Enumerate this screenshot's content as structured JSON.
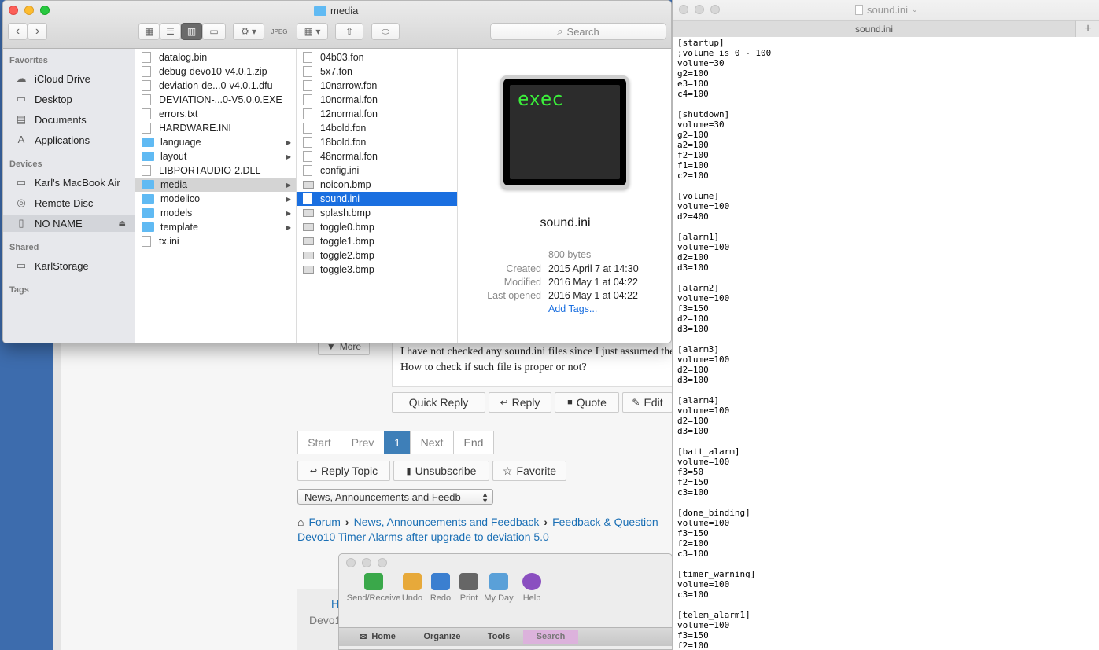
{
  "forum": {
    "more_label": "More",
    "post_line1": "I have not checked any sound.ini files since I just assumed the",
    "post_line2": "How to check if such file is proper or not?",
    "quick_reply": "Quick Reply",
    "reply": "Reply",
    "quote": "Quote",
    "edit": "Edit",
    "pagination": [
      "Start",
      "Prev",
      "1",
      "Next",
      "End"
    ],
    "reply_topic": "Reply Topic",
    "unsubscribe": "Unsubscribe",
    "favorite": "Favorite",
    "category_select": "News, Announcements and Feedb",
    "breadcrumb": [
      "Forum",
      "News, Announcements and Feedback",
      "Feedback & Question"
    ],
    "topic_title": "Devo10 Timer Alarms after upgrade to deviation 5.0",
    "footer_h": "H",
    "footer_devo": "Devo1"
  },
  "finder": {
    "title": "media",
    "search_placeholder": "Search",
    "sidebar": {
      "favorites_header": "Favorites",
      "favorites": [
        {
          "label": "iCloud Drive",
          "icon": "cloud-icon"
        },
        {
          "label": "Desktop",
          "icon": "desktop-icon"
        },
        {
          "label": "Documents",
          "icon": "documents-icon"
        },
        {
          "label": "Applications",
          "icon": "applications-icon"
        }
      ],
      "devices_header": "Devices",
      "devices": [
        {
          "label": "Karl's MacBook Air",
          "icon": "laptop-icon"
        },
        {
          "label": "Remote Disc",
          "icon": "disc-icon"
        },
        {
          "label": "NO NAME",
          "icon": "drive-icon"
        }
      ],
      "shared_header": "Shared",
      "shared": [
        {
          "label": "KarlStorage",
          "icon": "server-icon"
        }
      ],
      "tags_header": "Tags"
    },
    "column1": [
      {
        "name": "datalog.bin",
        "kind": "file"
      },
      {
        "name": "debug-devo10-v4.0.1.zip",
        "kind": "file"
      },
      {
        "name": "deviation-de...0-v4.0.1.dfu",
        "kind": "file"
      },
      {
        "name": "DEVIATION-...0-V5.0.0.EXE",
        "kind": "file"
      },
      {
        "name": "errors.txt",
        "kind": "file"
      },
      {
        "name": "HARDWARE.INI",
        "kind": "file"
      },
      {
        "name": "language",
        "kind": "folder"
      },
      {
        "name": "layout",
        "kind": "folder"
      },
      {
        "name": "LIBPORTAUDIO-2.DLL",
        "kind": "file"
      },
      {
        "name": "media",
        "kind": "folder"
      },
      {
        "name": "modelico",
        "kind": "folder"
      },
      {
        "name": "models",
        "kind": "folder"
      },
      {
        "name": "template",
        "kind": "folder"
      },
      {
        "name": "tx.ini",
        "kind": "file"
      }
    ],
    "column2": [
      {
        "name": "04b03.fon",
        "kind": "file"
      },
      {
        "name": "5x7.fon",
        "kind": "file"
      },
      {
        "name": "10narrow.fon",
        "kind": "file"
      },
      {
        "name": "10normal.fon",
        "kind": "file"
      },
      {
        "name": "12normal.fon",
        "kind": "file"
      },
      {
        "name": "14bold.fon",
        "kind": "file"
      },
      {
        "name": "18bold.fon",
        "kind": "file"
      },
      {
        "name": "48normal.fon",
        "kind": "file"
      },
      {
        "name": "config.ini",
        "kind": "file"
      },
      {
        "name": "noicon.bmp",
        "kind": "image"
      },
      {
        "name": "sound.ini",
        "kind": "file"
      },
      {
        "name": "splash.bmp",
        "kind": "image"
      },
      {
        "name": "toggle0.bmp",
        "kind": "image"
      },
      {
        "name": "toggle1.bmp",
        "kind": "image"
      },
      {
        "name": "toggle2.bmp",
        "kind": "image"
      },
      {
        "name": "toggle3.bmp",
        "kind": "image"
      }
    ],
    "preview": {
      "icon_text": "exec",
      "filename": "sound.ini",
      "size": "800 bytes",
      "created_label": "Created",
      "created": "2015 April 7 at 14:30",
      "modified_label": "Modified",
      "modified": "2016 May 1 at 04:22",
      "opened_label": "Last opened",
      "opened": "2016 May 1 at 04:22",
      "add_tags": "Add Tags..."
    }
  },
  "textedit": {
    "title": "sound.ini",
    "tab": "sound.ini",
    "content": "[startup]\n;volume is 0 - 100\nvolume=30\ng2=100\ne3=100\nc4=100\n\n[shutdown]\nvolume=30\ng2=100\na2=100\nf2=100\nf1=100\nc2=100\n\n[volume]\nvolume=100\nd2=400\n\n[alarm1]\nvolume=100\nd2=100\nd3=100\n\n[alarm2]\nvolume=100\nf3=150\nd2=100\nd3=100\n\n[alarm3]\nvolume=100\nd2=100\nd3=100\n\n[alarm4]\nvolume=100\nd2=100\nd3=100\n\n[batt_alarm]\nvolume=100\nf3=50\nf2=150\nc3=100\n\n[done_binding]\nvolume=100\nf3=150\nf2=100\nc3=100\n\n[timer_warning]\nvolume=100\nc3=100\n\n[telem_alarm1]\nvolume=100\nf3=150\nf2=100"
  },
  "entourage": {
    "toolbar": [
      {
        "label": "Send/Receive",
        "icon": "send-receive-icon",
        "color": "#3aa84a"
      },
      {
        "label": "Undo",
        "icon": "undo-icon",
        "color": "#e7a93a"
      },
      {
        "label": "Redo",
        "icon": "redo-icon",
        "color": "#3b7fd0"
      },
      {
        "label": "Print",
        "icon": "print-icon",
        "color": "#666666"
      },
      {
        "label": "My Day",
        "icon": "my-day-icon",
        "color": "#5aa0d8"
      },
      {
        "label": "Help",
        "icon": "help-icon",
        "color": "#8a4fc0"
      }
    ],
    "tabs": [
      "Home",
      "Organize",
      "Tools",
      "Search"
    ]
  },
  "colors": {
    "selection": "#1a6fe0",
    "folder": "#60baf3",
    "link": "#1a6fb5",
    "pagination_active": "#3e7fb8"
  }
}
